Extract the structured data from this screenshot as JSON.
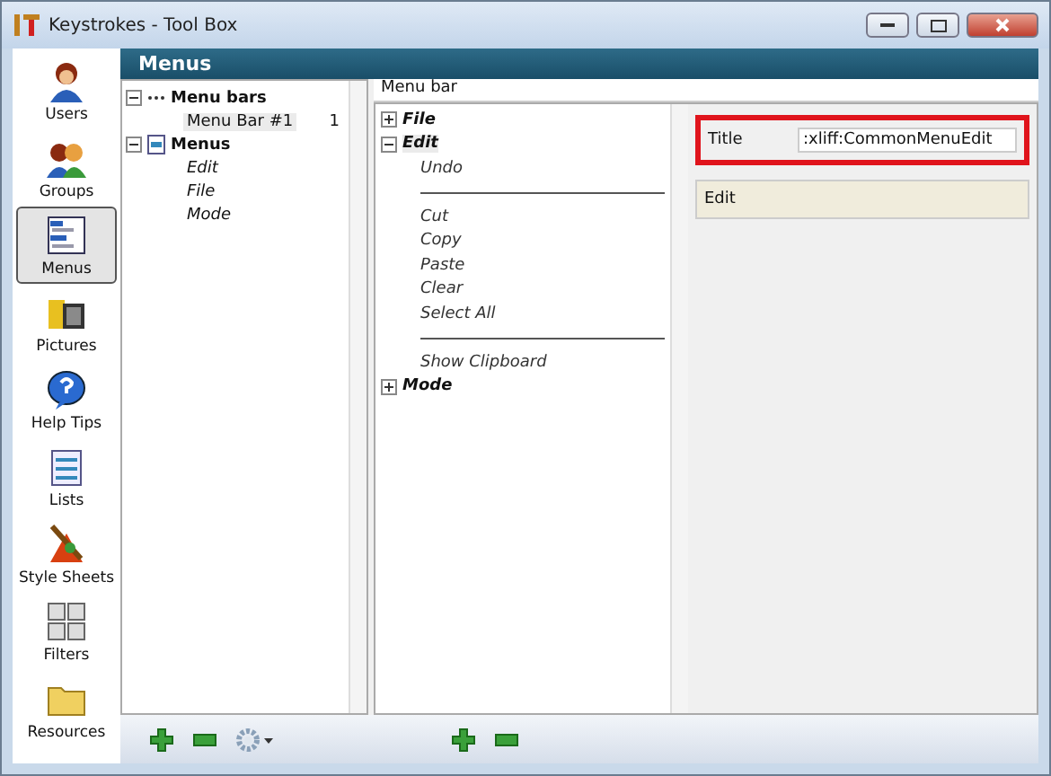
{
  "window": {
    "title": "Keystrokes - Tool Box"
  },
  "sidebar": {
    "items": [
      {
        "label": "Users",
        "selected": false
      },
      {
        "label": "Groups",
        "selected": false
      },
      {
        "label": "Menus",
        "selected": true
      },
      {
        "label": "Pictures",
        "selected": false
      },
      {
        "label": "Help Tips",
        "selected": false
      },
      {
        "label": "Lists",
        "selected": false
      },
      {
        "label": "Style Sheets",
        "selected": false
      },
      {
        "label": "Filters",
        "selected": false
      },
      {
        "label": "Resources",
        "selected": false
      }
    ]
  },
  "header": {
    "title": "Menus"
  },
  "tree": [
    {
      "kind": "bars",
      "label": "Menu bars",
      "expanded": true,
      "children": [
        {
          "label": "Menu Bar #1",
          "count": "1",
          "selected": true
        }
      ]
    },
    {
      "kind": "menus",
      "label": "Menus",
      "expanded": true,
      "children": [
        {
          "label": "Edit",
          "selected": false
        },
        {
          "label": "File",
          "selected": false
        },
        {
          "label": "Mode",
          "selected": false
        }
      ]
    }
  ],
  "menu_editor": {
    "label": "Menu bar",
    "menus": [
      {
        "label": "File",
        "expanded": false,
        "selected": false
      },
      {
        "label": "Edit",
        "expanded": true,
        "selected": true,
        "items": [
          {
            "kind": "item",
            "label": "Undo"
          },
          {
            "kind": "separator"
          },
          {
            "kind": "item",
            "label": "Cut"
          },
          {
            "kind": "item",
            "label": "Copy"
          },
          {
            "kind": "item",
            "label": "Paste"
          },
          {
            "kind": "item",
            "label": "Clear"
          },
          {
            "kind": "item",
            "label": "Select All"
          },
          {
            "kind": "separator"
          },
          {
            "kind": "item",
            "label": "Show Clipboard"
          }
        ]
      },
      {
        "label": "Mode",
        "expanded": false,
        "selected": false
      }
    ]
  },
  "properties": {
    "fields": [
      {
        "label": "Title",
        "value": ":xliff:CommonMenuEdit",
        "highlighted": true
      }
    ],
    "preview": "Edit"
  }
}
